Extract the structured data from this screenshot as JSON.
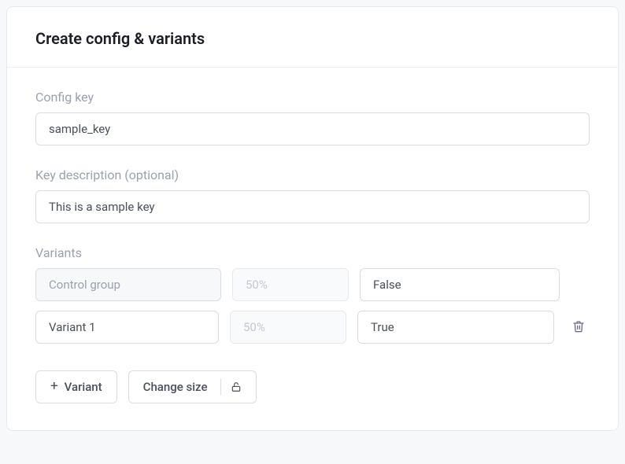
{
  "header": {
    "title": "Create config & variants"
  },
  "config_key": {
    "label": "Config key",
    "value": "sample_key"
  },
  "key_description": {
    "label": "Key description (optional)",
    "value": "This is a sample key"
  },
  "variants": {
    "label": "Variants",
    "rows": [
      {
        "name": "Control group",
        "name_readonly": true,
        "percent": "50%",
        "value": "False",
        "deletable": false
      },
      {
        "name": "Variant 1",
        "name_readonly": false,
        "percent": "50%",
        "value": "True",
        "deletable": true
      }
    ]
  },
  "actions": {
    "add_variant_label": "Variant",
    "change_size_label": "Change size"
  }
}
